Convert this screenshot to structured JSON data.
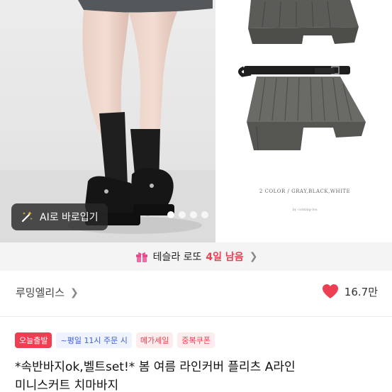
{
  "hero": {
    "ai_button_label": "AI로 바로입기",
    "slide_count": 4,
    "active_slide": 1,
    "caption_color": "2 COLOR / GRAY,BLACK,WHITE",
    "caption_brand": "by coming-los"
  },
  "lottery": {
    "label": "테슬라 로또",
    "days_left": "4일 남음",
    "accent": "#ee3e52"
  },
  "shop": {
    "name": "루밍엘리스",
    "likes": "16.7만",
    "heart_color": "#ee3e52"
  },
  "badges": {
    "today": "오늘출발",
    "time": "~평일 11시 주문 시",
    "mega": "메가세일",
    "coupon": "중복쿠폰"
  },
  "product": {
    "title_line1": "*속반바지ok,벨트set!* 봄 여름 라인커버 플리츠 A라인",
    "title_line2": "미니스커트 치마바지"
  }
}
